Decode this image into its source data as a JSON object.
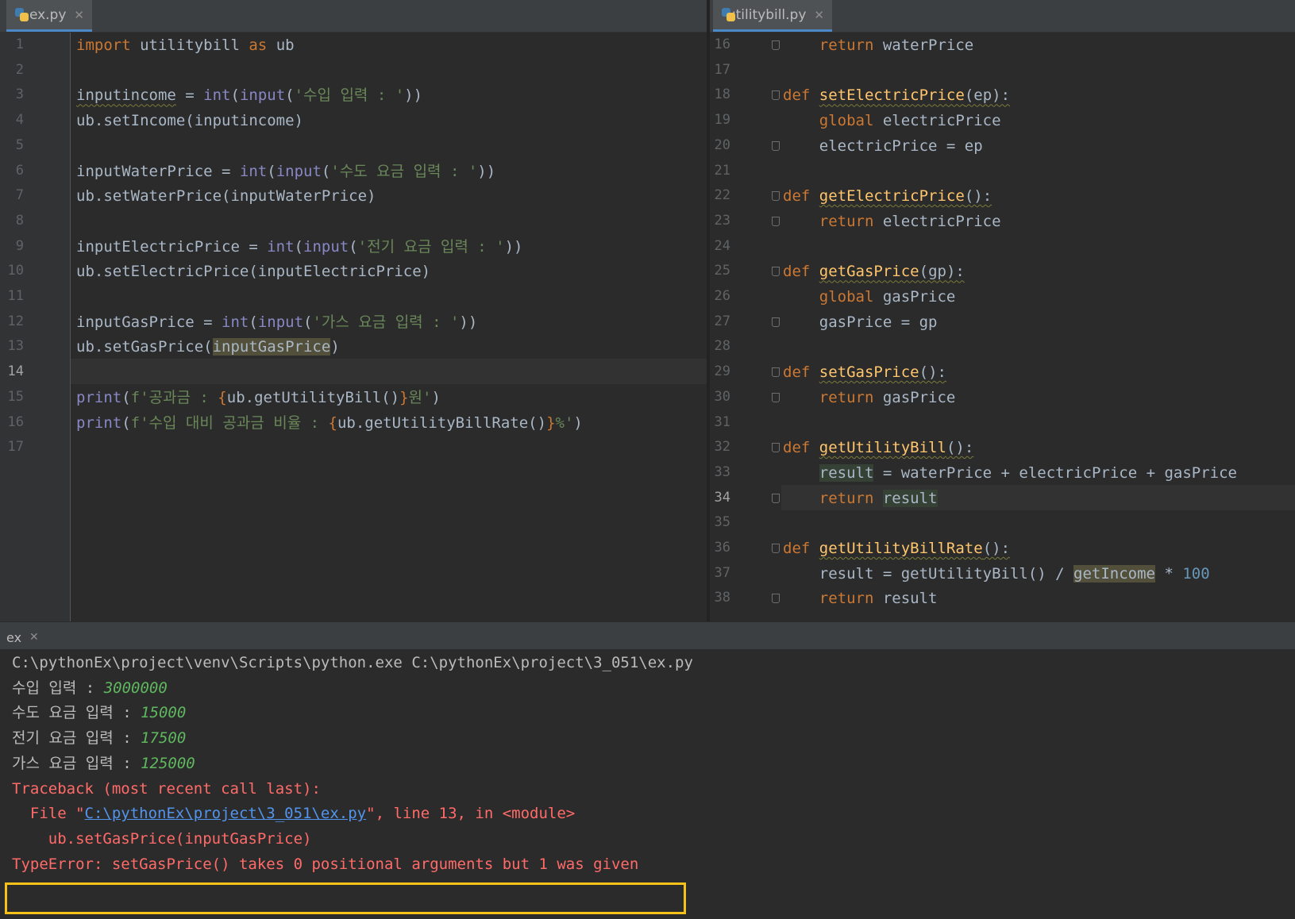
{
  "left_tab": {
    "label": "ex.py"
  },
  "right_tab": {
    "label": "utilitybill.py"
  },
  "left_lines": [
    {
      "n": "1",
      "html": "<span class=\"kw\">import</span> utilitybill <span class=\"kw\">as</span> ub"
    },
    {
      "n": "2",
      "html": ""
    },
    {
      "n": "3",
      "html": "<span class=\"wavy\">inputincome</span> = <span class=\"bi\">int</span>(<span class=\"bi\">input</span>(<span class=\"str\">'수입 입력 : '</span>))"
    },
    {
      "n": "4",
      "html": "ub.setIncome(inputincome)"
    },
    {
      "n": "5",
      "html": ""
    },
    {
      "n": "6",
      "html": "inputWaterPrice = <span class=\"bi\">int</span>(<span class=\"bi\">input</span>(<span class=\"str\">'수도 요금 입력 : '</span>))"
    },
    {
      "n": "7",
      "html": "ub.setWaterPrice(inputWaterPrice)"
    },
    {
      "n": "8",
      "html": ""
    },
    {
      "n": "9",
      "html": "inputElectricPrice = <span class=\"bi\">int</span>(<span class=\"bi\">input</span>(<span class=\"str\">'전기 요금 입력 : '</span>))"
    },
    {
      "n": "10",
      "html": "ub.setElectricPrice(inputElectricPrice)"
    },
    {
      "n": "11",
      "html": ""
    },
    {
      "n": "12",
      "html": "inputGasPrice = <span class=\"bi\">int</span>(<span class=\"bi\">input</span>(<span class=\"str\">'가스 요금 입력 : '</span>))"
    },
    {
      "n": "13",
      "html": "ub.setGasPrice(<span class=\"hl\">inputGasPrice</span>)"
    },
    {
      "n": "14",
      "html": ""
    },
    {
      "n": "15",
      "html": "<span class=\"bi\">print</span>(<span class=\"str\">f'공과금 : </span><span class=\"kw\">{</span>ub.getUtilityBill()<span class=\"kw\">}</span><span class=\"str\">원'</span>)"
    },
    {
      "n": "16",
      "html": "<span class=\"bi\">print</span>(<span class=\"str\">f'수입 대비 공과금 비율 : </span><span class=\"kw\">{</span>ub.getUtilityBillRate()<span class=\"kw\">}</span><span class=\"str\">%'</span>)"
    },
    {
      "n": "17",
      "html": ""
    }
  ],
  "right_lines": [
    {
      "n": "16",
      "html": "    <span class=\"kw\">return</span> waterPrice"
    },
    {
      "n": "17",
      "html": ""
    },
    {
      "n": "18",
      "html": "<span class=\"kw\">def</span> <span class=\"fn wavy\">setElectricPrice</span><span class=\"wavy\">(ep):</span>"
    },
    {
      "n": "19",
      "html": "    <span class=\"kw\">global</span> electricPrice"
    },
    {
      "n": "20",
      "html": "    electricPrice = ep"
    },
    {
      "n": "21",
      "html": ""
    },
    {
      "n": "22",
      "html": "<span class=\"kw\">def</span> <span class=\"fn wavy\">getElectricPrice</span><span class=\"wavy\">():</span>"
    },
    {
      "n": "23",
      "html": "    <span class=\"kw\">return</span> electricPrice"
    },
    {
      "n": "24",
      "html": ""
    },
    {
      "n": "25",
      "html": "<span class=\"kw\">def</span> <span class=\"fn wavy\">getGasPrice</span><span class=\"wavy\">(gp):</span>"
    },
    {
      "n": "26",
      "html": "    <span class=\"kw\">global</span> gasPrice"
    },
    {
      "n": "27",
      "html": "    gasPrice = gp"
    },
    {
      "n": "28",
      "html": ""
    },
    {
      "n": "29",
      "html": "<span class=\"kw\">def</span> <span class=\"fn wavy\">setGasPrice</span><span class=\"wavy\">():</span>"
    },
    {
      "n": "30",
      "html": "    <span class=\"kw\">return</span> gasPrice"
    },
    {
      "n": "31",
      "html": ""
    },
    {
      "n": "32",
      "html": "<span class=\"kw\">def</span> <span class=\"fn wavy\">getUtilityBill</span><span class=\"wavy\">():</span>"
    },
    {
      "n": "33",
      "html": "    <span class=\"hl2\">result</span> = waterPrice + electricPrice + gasPrice"
    },
    {
      "n": "34",
      "html": "    <span class=\"kw\">return</span> <span class=\"hl2\">result</span>"
    },
    {
      "n": "35",
      "html": ""
    },
    {
      "n": "36",
      "html": "<span class=\"kw\">def</span> <span class=\"fn wavy\">getUtilityBillRate</span><span class=\"wavy\">():</span>"
    },
    {
      "n": "37",
      "html": "    result = getUtilityBill() / <span class=\"hl\">getIncome</span> * <span class=\"num\">100</span>"
    },
    {
      "n": "38",
      "html": "    <span class=\"kw\">return</span> result"
    }
  ],
  "run_tab": {
    "label": "ex"
  },
  "console_lines": [
    {
      "html": "C:\\pythonEx\\project\\venv\\Scripts\\python.exe C:\\pythonEx\\project\\3_051\\ex.py"
    },
    {
      "html": "수입 입력 : <span class=\"in\">3000000</span>"
    },
    {
      "html": "수도 요금 입력 : <span class=\"in\">15000</span>"
    },
    {
      "html": "전기 요금 입력 : <span class=\"in\">17500</span>"
    },
    {
      "html": "가스 요금 입력 : <span class=\"in\">125000</span>"
    },
    {
      "html": "<span class=\"err\">Traceback (most recent call last):</span>"
    },
    {
      "html": "<span class=\"err\">  File \"</span><span class=\"link\">C:\\pythonEx\\project\\3_051\\ex.py</span><span class=\"err\">\", line 13, in &lt;module&gt;</span>"
    },
    {
      "html": "<span class=\"err\">    ub.setGasPrice(inputGasPrice)</span>"
    },
    {
      "html": "<span class=\"err\">TypeError: setGasPrice() takes 0 positional arguments but 1 was given</span>"
    }
  ]
}
